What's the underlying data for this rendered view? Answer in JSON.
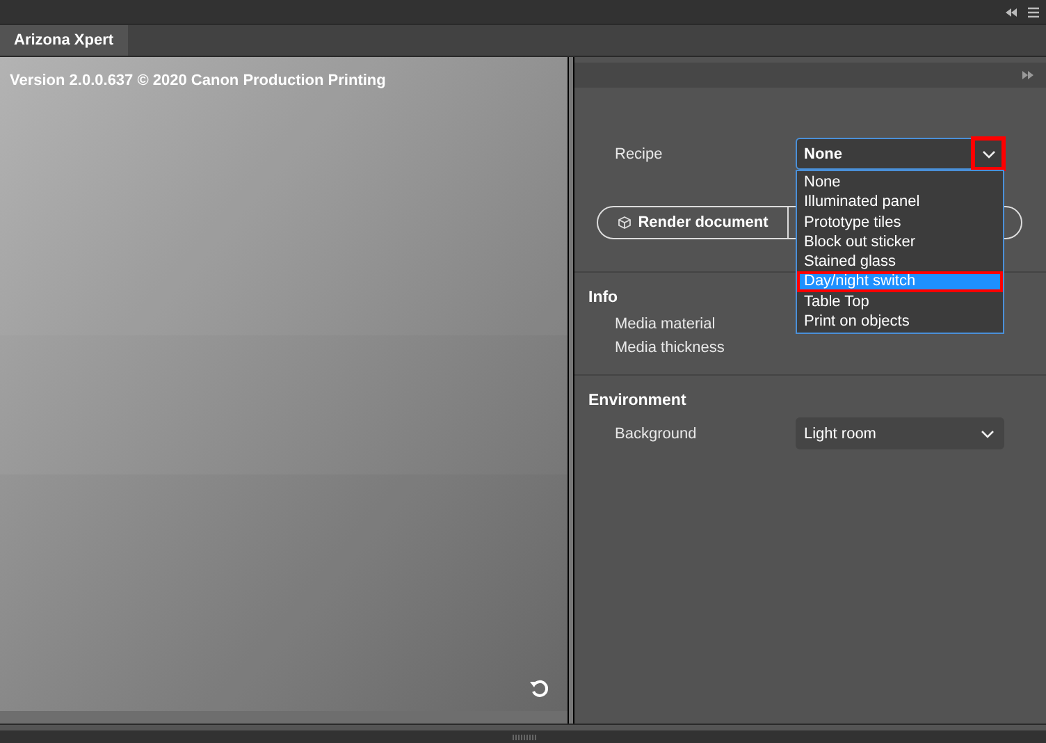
{
  "tab": {
    "label": "Arizona Xpert",
    "selected": true
  },
  "preview": {
    "version_text": "Version 2.0.0.637 © 2020 Canon Production Printing"
  },
  "recipe": {
    "label": "Recipe",
    "value": "None",
    "expanded": true,
    "options": [
      {
        "label": "None",
        "highlighted": false
      },
      {
        "label": "Illuminated panel",
        "highlighted": false
      },
      {
        "label": "Prototype tiles",
        "highlighted": false
      },
      {
        "label": "Block out sticker",
        "highlighted": false
      },
      {
        "label": "Stained glass",
        "highlighted": false
      },
      {
        "label": "Day/night switch",
        "highlighted": true
      },
      {
        "label": "Table Top",
        "highlighted": false
      },
      {
        "label": "Print on objects",
        "highlighted": false
      }
    ]
  },
  "render_button": {
    "label": "Render document"
  },
  "info": {
    "title": "Info",
    "rows": [
      {
        "label": "Media material"
      },
      {
        "label": "Media thickness"
      }
    ]
  },
  "environment": {
    "title": "Environment",
    "background": {
      "label": "Background",
      "value": "Light room"
    }
  }
}
